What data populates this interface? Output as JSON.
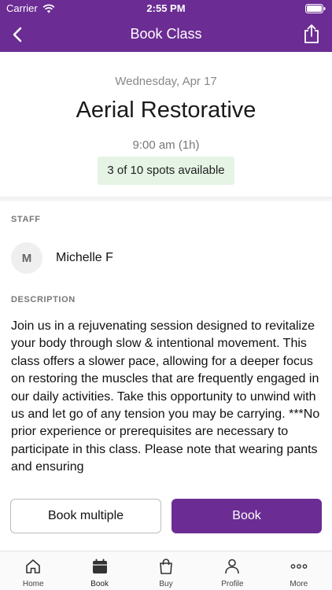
{
  "status_bar": {
    "carrier": "Carrier",
    "time": "2:55 PM"
  },
  "nav": {
    "title": "Book Class",
    "back_icon": "chevron-left-icon",
    "share_icon": "share-icon"
  },
  "class_info": {
    "date": "Wednesday, Apr 17",
    "name": "Aerial Restorative",
    "time": "9:00 am (1h)",
    "availability": "3 of 10 spots available"
  },
  "staff": {
    "section_label": "STAFF",
    "avatar_initial": "M",
    "name": "Michelle F"
  },
  "description": {
    "section_label": "DESCRIPTION",
    "text": "Join us in a rejuvenating session designed to revitalize your body through slow & intentional movement. This class offers a slower pace, allowing for a deeper focus on restoring the muscles that are frequently engaged in our daily activities. Take this opportunity to unwind with us and let go of any tension you may be carrying. ***No prior experience or prerequisites are necessary to participate in this class. Please note that wearing pants and ensuring"
  },
  "actions": {
    "book_multiple": "Book multiple",
    "book": "Book"
  },
  "tabs": [
    {
      "label": "Home",
      "icon": "home-icon",
      "active": false
    },
    {
      "label": "Book",
      "icon": "calendar-icon",
      "active": true
    },
    {
      "label": "Buy",
      "icon": "shopping-bag-icon",
      "active": false
    },
    {
      "label": "Profile",
      "icon": "person-icon",
      "active": false
    },
    {
      "label": "More",
      "icon": "more-dots-icon",
      "active": false
    }
  ],
  "colors": {
    "brand": "#6b2c93",
    "availability_bg": "#e5f4e5"
  }
}
